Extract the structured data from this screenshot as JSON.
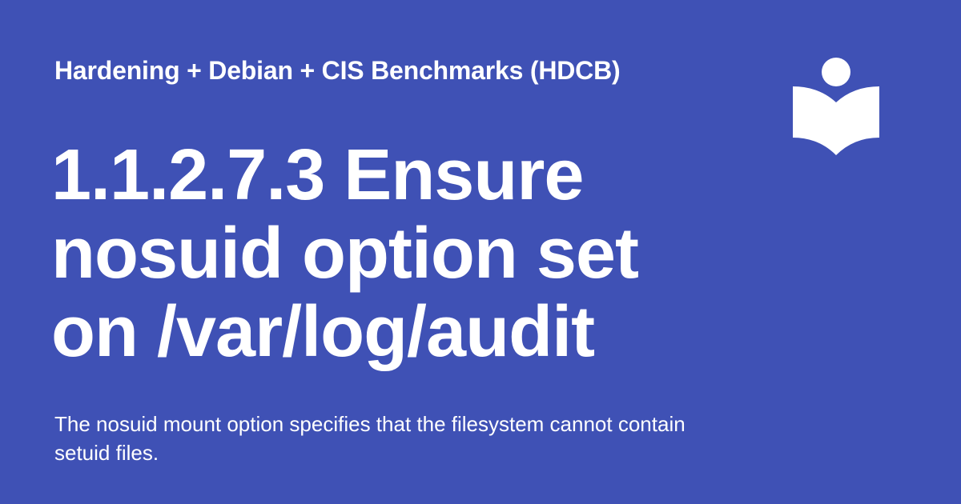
{
  "site_name": "Hardening + Debian + CIS Benchmarks (HDCB)",
  "page_title": "1.1.2.7.3 Ensure nosuid option set on /var/log/audit",
  "description": "The nosuid mount option specifies that the filesystem cannot contain setuid files.",
  "logo_icon": "book-reader-icon",
  "colors": {
    "background": "#3f51b5",
    "foreground": "#ffffff"
  }
}
